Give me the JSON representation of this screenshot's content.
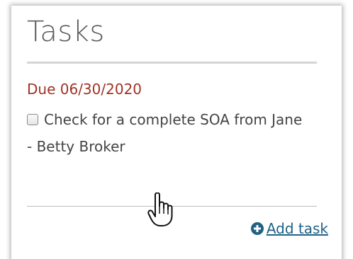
{
  "panel": {
    "title": "Tasks"
  },
  "task": {
    "due": "Due 06/30/2020",
    "text": "Check for a complete SOA from Jane",
    "assignee": "- Betty Broker",
    "checked": false
  },
  "actions": {
    "add_task_label": "Add task",
    "add_task_icon": "plus-circle-icon"
  },
  "colors": {
    "due": "#a03226",
    "link": "#1f6286",
    "title": "#5a5a5a",
    "body_text": "#444444"
  },
  "cursor": {
    "icon": "hand-pointer-icon"
  }
}
